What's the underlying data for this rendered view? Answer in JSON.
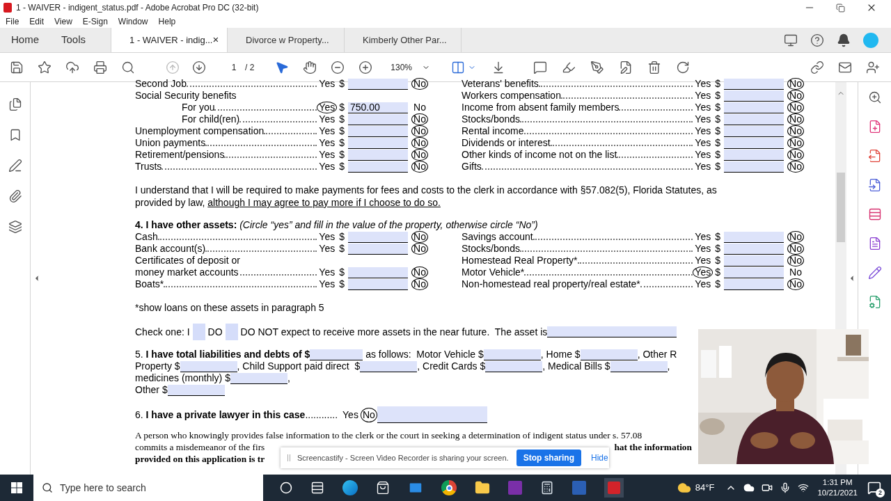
{
  "window": {
    "title": "1 - WAIVER - indigent_status.pdf - Adobe Acrobat Pro DC (32-bit)"
  },
  "menu": [
    "File",
    "Edit",
    "View",
    "E-Sign",
    "Window",
    "Help"
  ],
  "nav": [
    "Home",
    "Tools"
  ],
  "tabs": [
    {
      "label": "1 - WAIVER - indig...",
      "selected": true,
      "close": "×"
    },
    {
      "label": "Divorce w Property...",
      "selected": false
    },
    {
      "label": "Kimberly Other Par...",
      "selected": false
    }
  ],
  "toolbar": {
    "page": "1",
    "page_count": "/ 2",
    "zoom": "130%"
  },
  "income": {
    "left": [
      {
        "label": "Second Job",
        "yes": "Yes",
        "currency": "$",
        "no": "No",
        "yes_circled": false,
        "no_circled": true
      },
      {
        "label": "Social Security benefits",
        "children": [
          {
            "label": "For you",
            "yes": "Yes",
            "currency": "$",
            "value": "750.00",
            "no": "No",
            "yes_circled": true,
            "no_circled": false
          },
          {
            "label": "For child(ren)",
            "yes": "Yes",
            "currency": "$",
            "no": "No",
            "yes_circled": false,
            "no_circled": true
          }
        ]
      },
      {
        "label": "Unemployment compensation",
        "yes": "Yes",
        "currency": "$",
        "no": "No",
        "yes_circled": false,
        "no_circled": true
      },
      {
        "label": "Union payments",
        "yes": "Yes",
        "currency": "$",
        "no": "No",
        "yes_circled": false,
        "no_circled": true
      },
      {
        "label": "Retirement/pensions",
        "yes": "Yes",
        "currency": "$",
        "no": "No",
        "yes_circled": false,
        "no_circled": true
      },
      {
        "label": "Trusts",
        "yes": "Yes",
        "currency": "$",
        "no": "No",
        "yes_circled": false,
        "no_circled": true
      }
    ],
    "right": [
      {
        "label": "Veterans' benefits",
        "yes": "Yes",
        "currency": "$",
        "no": "No",
        "yes_circled": false,
        "no_circled": true
      },
      {
        "label": "Workers compensation",
        "yes": "Yes",
        "currency": "$",
        "no": "No",
        "yes_circled": false,
        "no_circled": true
      },
      {
        "label": "Income from absent family members",
        "yes": "Yes",
        "currency": "$",
        "no": "No",
        "yes_circled": false,
        "no_circled": true
      },
      {
        "label": "Stocks/bonds",
        "yes": "Yes",
        "currency": "$",
        "no": "No",
        "yes_circled": false,
        "no_circled": true
      },
      {
        "label": "Rental income",
        "yes": "Yes",
        "currency": "$",
        "no": "No",
        "yes_circled": false,
        "no_circled": true
      },
      {
        "label": "Dividends or interest",
        "yes": "Yes",
        "currency": "$",
        "no": "No",
        "yes_circled": false,
        "no_circled": true
      },
      {
        "label": "Other kinds of income not on the list",
        "yes": "Yes",
        "currency": "$",
        "no": "No",
        "yes_circled": false,
        "no_circled": true
      },
      {
        "label": "Gifts",
        "yes": "Yes",
        "currency": "$",
        "no": "No",
        "yes_circled": false,
        "no_circled": true
      }
    ]
  },
  "understand": {
    "text": "I understand that I will be required to make payments for fees and costs to the clerk in accordance with §57.082(5), Florida Statutes, as provided by law, ",
    "underlined": "although I may agree to pay more if I choose to do so."
  },
  "assets": {
    "heading": "**4. I have other assets:** *(Circle “yes” and fill in the value of the property, otherwise circle “No”)*",
    "left": [
      {
        "label": "Cash",
        "yes": "Yes",
        "currency": "$",
        "no": "No",
        "yes_circled": false,
        "no_circled": true
      },
      {
        "label": "Bank account(s)",
        "yes": "Yes",
        "currency": "$",
        "no": "No",
        "yes_circled": false,
        "no_circled": true
      },
      {
        "label_lines": [
          "Certificates of deposit or",
          "money market accounts"
        ],
        "yes": "Yes",
        "currency": "$",
        "no": "No",
        "yes_circled": false,
        "no_circled": true
      },
      {
        "label": "Boats*",
        "yes": "Yes",
        "currency": "$",
        "no": "No",
        "yes_circled": false,
        "no_circled": true
      }
    ],
    "right": [
      {
        "label": "Savings account",
        "yes": "Yes",
        "currency": "$",
        "no": "No",
        "yes_circled": false,
        "no_circled": true
      },
      {
        "label": "Stocks/bonds",
        "yes": "Yes",
        "currency": "$",
        "no": "No",
        "yes_circled": false,
        "no_circled": true
      },
      {
        "label": "Homestead Real Property*",
        "yes": "Yes",
        "currency": "$",
        "no": "No",
        "yes_circled": false,
        "no_circled": true
      },
      {
        "label": "Motor Vehicle*",
        "yes": "Yes",
        "currency": "$",
        "no": "No",
        "yes_circled": true,
        "no_circled": false
      },
      {
        "label": "Non-homestead real property/real estate*",
        "yes": "Yes",
        "currency": "$",
        "no": "No",
        "yes_circled": false,
        "no_circled": true
      }
    ],
    "note": "*show loans on these assets in paragraph 5"
  },
  "check": {
    "prefix": "Check one: I",
    "options": [
      {
        "label": "DO",
        "checked": false
      },
      {
        "label": "DO NOT expect to receive more assets in the near future.  The asset is",
        "checked": false
      }
    ]
  },
  "debts": [
    [
      {
        "kind": "text",
        "text": "5. "
      },
      {
        "kind": "bold",
        "text": "I have total liabilities and debts of $"
      },
      {
        "kind": "field"
      },
      {
        "kind": "text",
        "text": " as follows:  Motor Vehicle $"
      },
      {
        "kind": "field"
      },
      {
        "kind": "text",
        "text": ", Home $"
      },
      {
        "kind": "field"
      },
      {
        "kind": "text",
        "text": ", Other R"
      }
    ],
    [
      {
        "kind": "text",
        "text": "Property $"
      },
      {
        "kind": "field"
      },
      {
        "kind": "text",
        "text": ", Child Support paid direct  $"
      },
      {
        "kind": "field"
      },
      {
        "kind": "text",
        "text": ", Credit Cards $"
      },
      {
        "kind": "field"
      },
      {
        "kind": "text",
        "text": ", Medical Bills $"
      },
      {
        "kind": "field"
      },
      {
        "kind": "text",
        "text": ","
      }
    ],
    [
      {
        "kind": "text",
        "text": "medicines (monthly) $"
      },
      {
        "kind": "field"
      },
      {
        "kind": "text",
        "text": ","
      }
    ],
    [
      {
        "kind": "text",
        "text": "Other $"
      },
      {
        "kind": "field"
      }
    ]
  ],
  "lawyer": {
    "number": "6. ",
    "text": "I have a private lawyer in this case",
    "leader": "............",
    "yes": "Yes",
    "no": "No",
    "yes_circled": false,
    "no_circled": true
  },
  "legal": [
    {
      "left": "A person who knowingly provides false information to the clerk or the court in seeking a determination of indigent status under s. 57.08"
    },
    {
      "left": "commits a misdemeanor of the firs",
      "right": "hat the information"
    },
    {
      "left": "provided on this application is tr"
    }
  ],
  "sharing_bar": {
    "message": "Screencastify - Screen Video Recorder is sharing your screen.",
    "stop": "Stop sharing",
    "hide": "Hide"
  },
  "webcam": {
    "kind": "picture"
  },
  "taskbar": {
    "search_placeholder": "Type here to search",
    "weather": "84°F",
    "time": "1:31 PM",
    "date": "10/21/2021",
    "notifications": "2"
  }
}
